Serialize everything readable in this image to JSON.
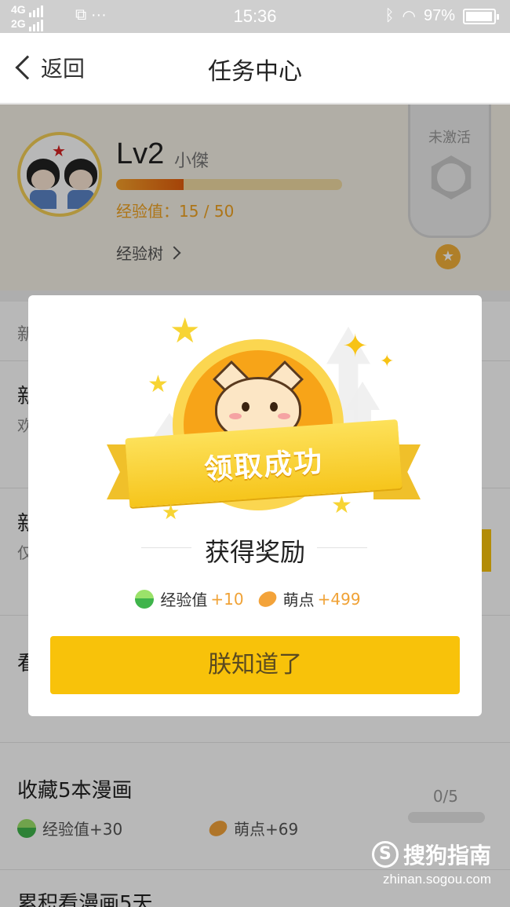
{
  "status_bar": {
    "network_top": "4G",
    "network_bottom": "2G",
    "time": "15:36",
    "battery": "97%"
  },
  "nav": {
    "back_label": "返回",
    "title": "任务中心"
  },
  "profile": {
    "level": "Lv2",
    "username": "小傑",
    "exp_text": "经验值：15 / 50",
    "exp_progress": 0.3,
    "exp_tree_label": "经验树",
    "badge_label": "未激活"
  },
  "tasks": [
    {
      "title": "新",
      "subtitle": "欢"
    },
    {
      "title": "新",
      "subtitle": "仅"
    },
    {
      "title": "看"
    },
    {
      "title": "收藏5本漫画",
      "exp": "经验值+30",
      "beans": "萌点+69",
      "progress": "0/5"
    },
    {
      "title": "累积看漫画5天"
    }
  ],
  "modal": {
    "banner": "领取成功",
    "heading": "获得奖励",
    "exp_label": "经验值",
    "exp_amount": "+10",
    "bean_label": "萌点",
    "bean_amount": "+499",
    "confirm": "朕知道了"
  },
  "watermark": {
    "brand": "搜狗指南",
    "url": "zhinan.sogou.com"
  },
  "colors": {
    "accent": "#f8c20a",
    "reward_orange": "#f0a236",
    "exp_green": "#3fb44b"
  }
}
